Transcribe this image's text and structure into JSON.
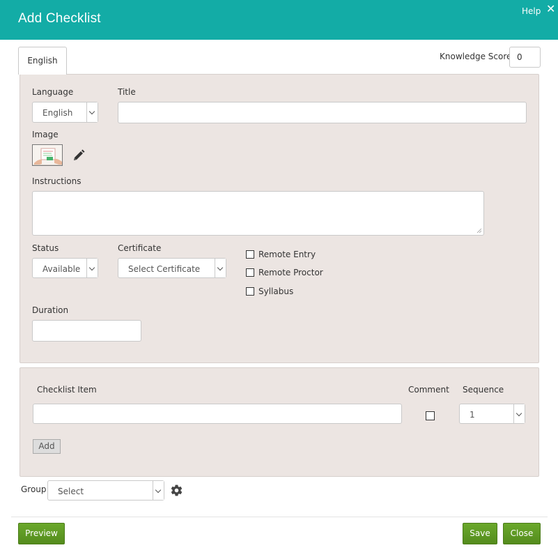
{
  "header": {
    "title": "Add Checklist",
    "help": "Help",
    "close_icon": "close-icon",
    "background_color": "#13aca6"
  },
  "tabs": [
    {
      "label": "English",
      "active": true
    }
  ],
  "knowledge_score": {
    "label": "Knowledge Score",
    "value": "0"
  },
  "form": {
    "language": {
      "label": "Language",
      "value": "English"
    },
    "title": {
      "label": "Title",
      "value": ""
    },
    "image": {
      "label": "Image",
      "edit_icon": "pencil-icon"
    },
    "instructions": {
      "label": "Instructions",
      "value": ""
    },
    "status": {
      "label": "Status",
      "value": "Available"
    },
    "certificate": {
      "label": "Certificate",
      "value": "Select Certificate"
    },
    "options": [
      {
        "label": "Remote Entry",
        "checked": false
      },
      {
        "label": "Remote Proctor",
        "checked": false
      },
      {
        "label": "Syllabus",
        "checked": false
      }
    ],
    "duration": {
      "label": "Duration",
      "value": ""
    }
  },
  "checklist": {
    "columns": {
      "item": "Checklist Item",
      "comment": "Comment",
      "sequence": "Sequence"
    },
    "rows": [
      {
        "item": "",
        "comment": false,
        "sequence": "1"
      }
    ],
    "add_label": "Add"
  },
  "group": {
    "label": "Group",
    "value": "Select",
    "settings_icon": "gear-icon"
  },
  "footer": {
    "preview": "Preview",
    "save": "Save",
    "close": "Close",
    "button_color": "#5f9a24"
  }
}
